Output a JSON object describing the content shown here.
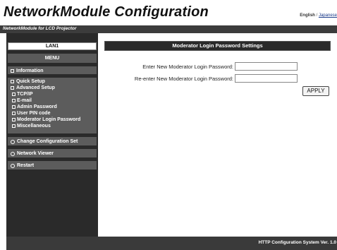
{
  "header": {
    "title": "NetworkModule Configuration",
    "language": {
      "current": "English",
      "separator": "/",
      "other": "Japanese"
    }
  },
  "subtitle": "NetworkModule for LCD Projector",
  "sidebar": {
    "lan_tab": "LAN1",
    "menu_label": "MENU",
    "information": "Information",
    "quick_setup": "Quick Setup",
    "advanced_setup": "Advanced Setup",
    "advanced_items": [
      "TCP/IP",
      "E-mail",
      "Admin Password",
      "User PIN code",
      "Moderator Login Password",
      "Miscellaneous"
    ],
    "change_configuration_set": "Change Configuration Set",
    "network_viewer": "Network Viewer",
    "restart": "Restart"
  },
  "main": {
    "section_title": "Moderator Login Password Settings",
    "new_password_label": "Enter New Moderator Login Password:",
    "new_password_value": "",
    "reenter_password_label": "Re-enter New Moderator Login Password:",
    "reenter_password_value": "",
    "apply_label": "APPLY"
  },
  "footer": {
    "text": "HTTP Configuration System Ver. 1.0"
  }
}
